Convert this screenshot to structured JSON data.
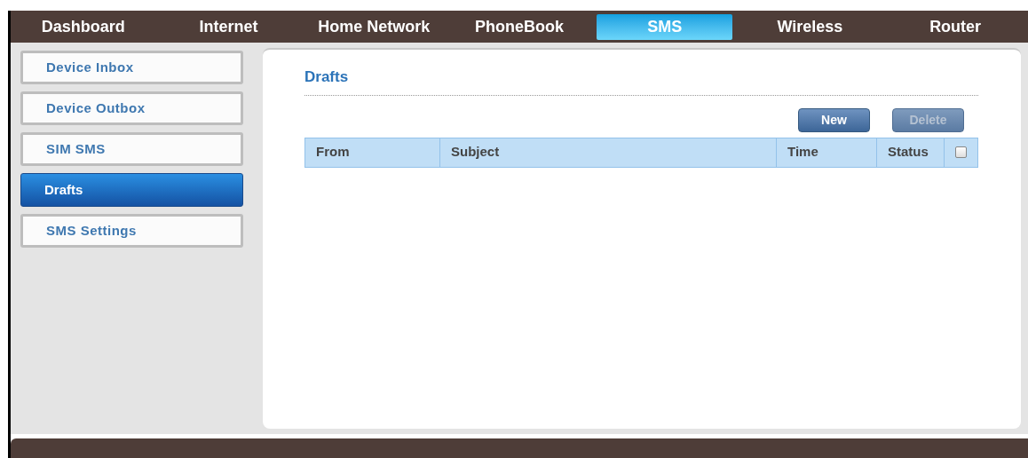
{
  "nav": [
    {
      "label": "Dashboard",
      "selected": false
    },
    {
      "label": "Internet",
      "selected": false
    },
    {
      "label": "Home Network",
      "selected": false
    },
    {
      "label": "PhoneBook",
      "selected": false
    },
    {
      "label": "SMS",
      "selected": true
    },
    {
      "label": "Wireless",
      "selected": false
    },
    {
      "label": "Router",
      "selected": false
    }
  ],
  "sidebar": {
    "items": [
      {
        "label": "Device Inbox",
        "selected": false
      },
      {
        "label": "Device Outbox",
        "selected": false
      },
      {
        "label": "SIM SMS",
        "selected": false
      },
      {
        "label": "Drafts",
        "selected": true
      },
      {
        "label": "SMS Settings",
        "selected": false
      }
    ]
  },
  "panel": {
    "title": "Drafts",
    "buttons": [
      {
        "label": "New",
        "disabled": false
      },
      {
        "label": "Delete",
        "disabled": true
      }
    ],
    "table": {
      "columns": [
        "From",
        "Subject",
        "Time",
        "Status"
      ],
      "select_all": {
        "checked": false
      }
    }
  }
}
